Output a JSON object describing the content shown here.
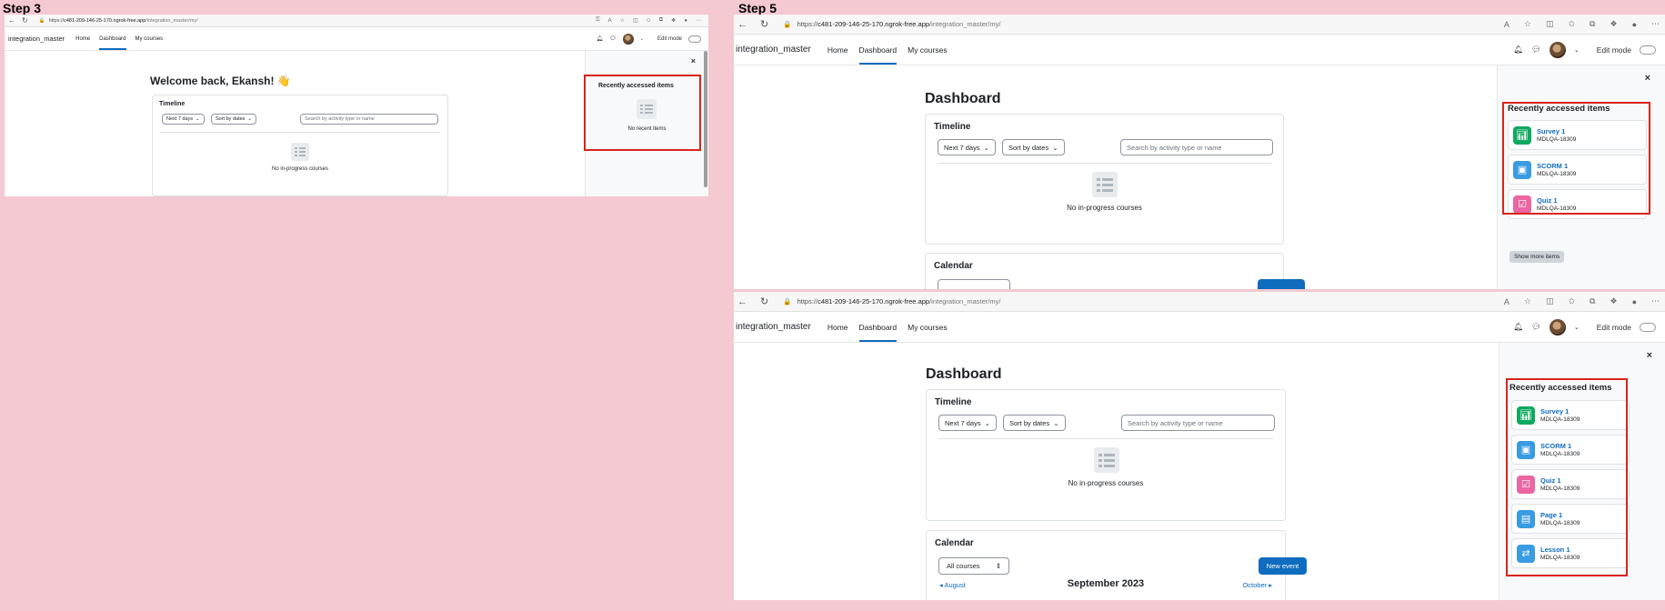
{
  "steps": {
    "step3": "Step 3",
    "step5": "Step 5"
  },
  "browser": {
    "url_prefix": "https://",
    "url_host": "c481-209-146-25-170.ngrok-free.app",
    "url_path": "/integration_master/my/"
  },
  "site": {
    "brand": "integration_master",
    "nav": [
      "Home",
      "Dashboard",
      "My courses"
    ],
    "edit_mode": "Edit mode"
  },
  "step3": {
    "welcome": "Welcome back, Ekansh! 👋",
    "timeline_title": "Timeline",
    "filter_days": "Next 7 days",
    "filter_sort": "Sort by dates",
    "search_placeholder": "Search by activity type or name",
    "empty_courses": "No in-progress courses",
    "recent_title": "Recently accessed items",
    "no_recent": "No recent items"
  },
  "step5a": {
    "page_title": "Dashboard",
    "timeline_title": "Timeline",
    "filter_days": "Next 7 days",
    "filter_sort": "Sort by dates",
    "search_placeholder": "Search by activity type or name",
    "empty_courses": "No in-progress courses",
    "calendar_title": "Calendar",
    "recent_title": "Recently accessed items",
    "items": [
      {
        "name": "Survey 1",
        "course": "MDLQA-18309",
        "icon": "survey-icon",
        "color": "#0fa95f"
      },
      {
        "name": "SCORM 1",
        "course": "MDLQA-18309",
        "icon": "scorm-icon",
        "color": "#399be2"
      },
      {
        "name": "Quiz 1",
        "course": "MDLQA-18309",
        "icon": "quiz-icon",
        "color": "#eb66a2"
      }
    ],
    "show_more": "Show more items"
  },
  "step5b": {
    "page_title": "Dashboard",
    "timeline_title": "Timeline",
    "filter_days": "Next 7 days",
    "filter_sort": "Sort by dates",
    "search_placeholder": "Search by activity type or name",
    "empty_courses": "No in-progress courses",
    "calendar_title": "Calendar",
    "all_courses": "All courses",
    "new_event": "New event",
    "prev_month": "August",
    "month_title": "September 2023",
    "next_month": "October",
    "recent_title": "Recently accessed items",
    "items": [
      {
        "name": "Survey 1",
        "course": "MDLQA-18309",
        "icon": "survey-icon",
        "color": "#0fa95f"
      },
      {
        "name": "SCORM 1",
        "course": "MDLQA-18309",
        "icon": "scorm-icon",
        "color": "#399be2"
      },
      {
        "name": "Quiz 1",
        "course": "MDLQA-18309",
        "icon": "quiz-icon",
        "color": "#eb66a2"
      },
      {
        "name": "Page 1",
        "course": "MDLQA-18309",
        "icon": "page-icon",
        "color": "#399be2"
      },
      {
        "name": "Lesson 1",
        "course": "MDLQA-18309",
        "icon": "lesson-icon",
        "color": "#399be2"
      }
    ]
  }
}
